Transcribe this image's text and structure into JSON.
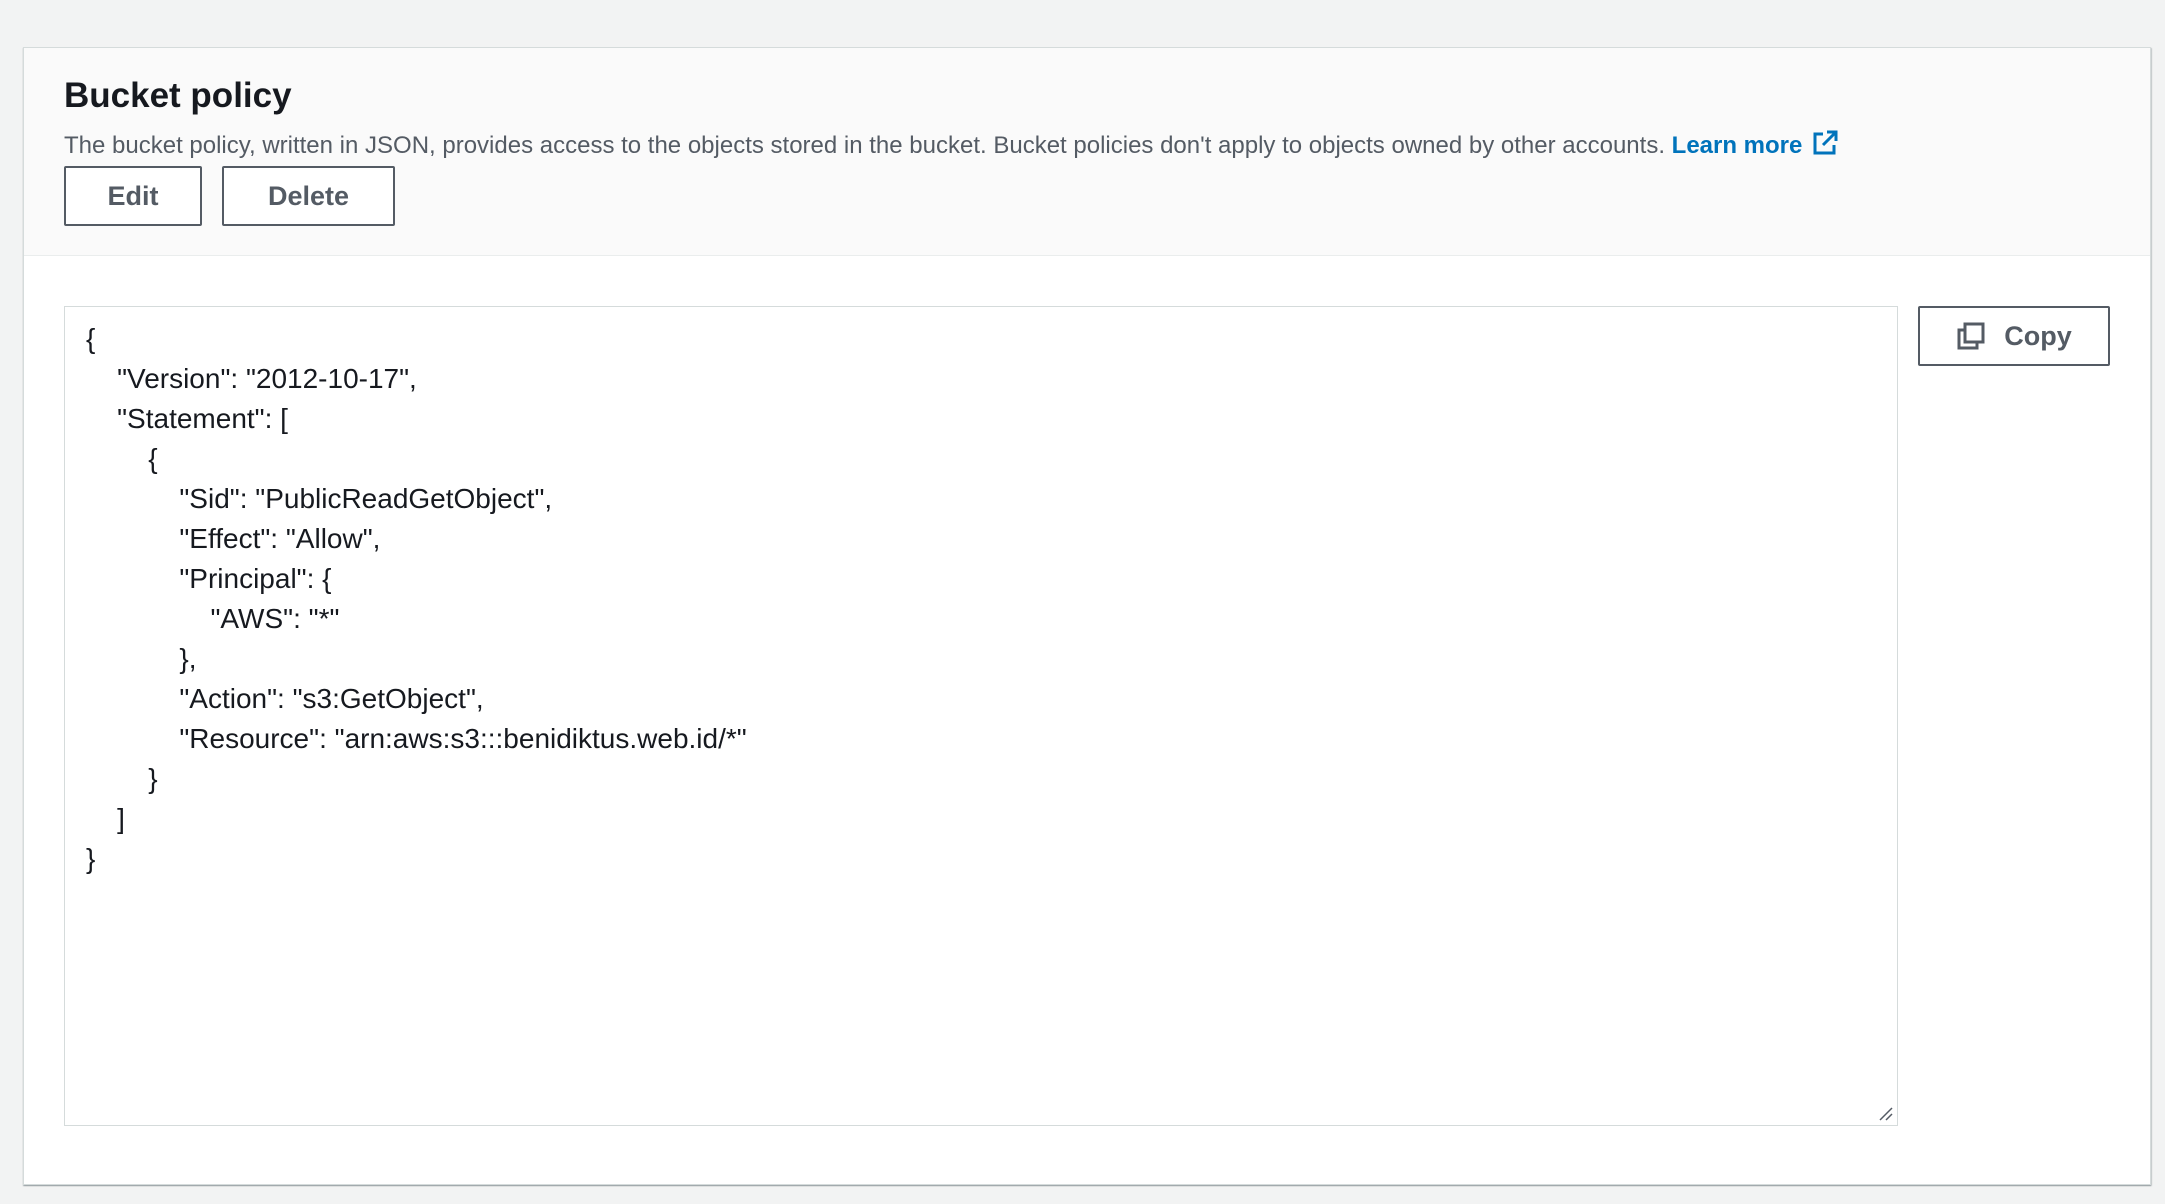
{
  "bucket_policy": {
    "title": "Bucket policy",
    "description": "The bucket policy, written in JSON, provides access to the objects stored in the bucket. Bucket policies don't apply to objects owned by other accounts.",
    "learn_more_label": "Learn more",
    "learn_more_icon": "external-link-icon",
    "edit_label": "Edit",
    "delete_label": "Delete",
    "copy_label": "Copy",
    "copy_icon": "copy-icon",
    "policy_json": "{\n    \"Version\": \"2012-10-17\",\n    \"Statement\": [\n        {\n            \"Sid\": \"PublicReadGetObject\",\n            \"Effect\": \"Allow\",\n            \"Principal\": {\n                \"AWS\": \"*\"\n            },\n            \"Action\": \"s3:GetObject\",\n            \"Resource\": \"arn:aws:s3:::benidiktus.web.id/*\"\n        }\n    ]\n}"
  },
  "colors": {
    "link": "#0073bb",
    "text": "#16191f",
    "secondary_text": "#545b64",
    "header_bg": "#fafafa",
    "page_bg": "#f2f3f3"
  }
}
